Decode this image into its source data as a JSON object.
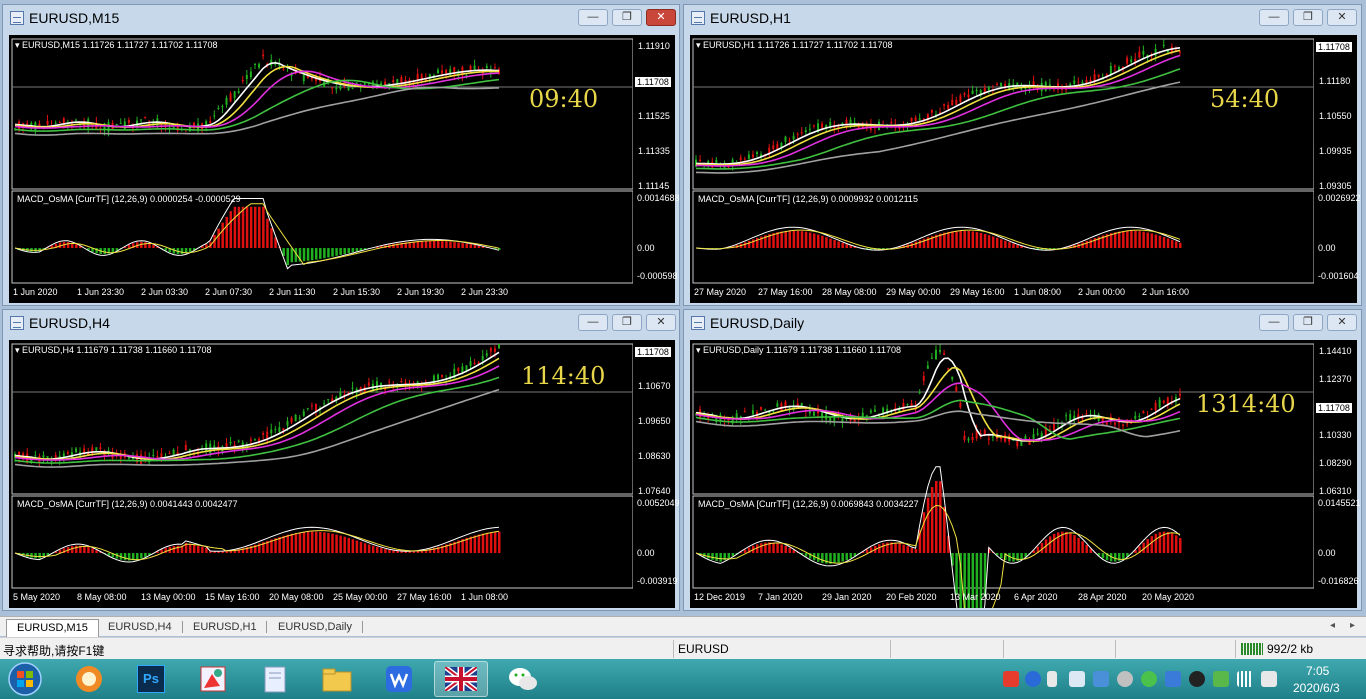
{
  "windows": [
    {
      "id": "m15",
      "title": "EURUSD,M15",
      "active": true,
      "info": "EURUSD,M15  1.11726 1.11727 1.11702 1.11708",
      "price_labels": [
        "1.11910",
        "1.11708",
        "1.11525",
        "1.11335",
        "1.11145"
      ],
      "current_price": "1.11708",
      "clock": "09:40",
      "macd_info": "MACD_OsMA [CurrTF] (12,26,9) 0.0000254 -0.0000529",
      "macd_labels": [
        "0.0014688",
        "0.00",
        "-0.000598"
      ],
      "time_labels": [
        "1 Jun 2020",
        "1 Jun 23:30",
        "2 Jun 03:30",
        "2 Jun 07:30",
        "2 Jun 11:30",
        "2 Jun 15:30",
        "2 Jun 19:30",
        "2 Jun 23:30"
      ]
    },
    {
      "id": "h1",
      "title": "EURUSD,H1",
      "active": false,
      "info": "EURUSD,H1  1.11726 1.11727 1.11702 1.11708",
      "price_labels": [
        "1.11708",
        "1.11180",
        "1.10550",
        "1.09935",
        "1.09305"
      ],
      "current_price": "1.11708",
      "clock": "54:40",
      "macd_info": "MACD_OsMA [CurrTF] (12,26,9) 0.0009932 0.0012115",
      "macd_labels": [
        "0.0026922",
        "0.00",
        "-0.001604"
      ],
      "time_labels": [
        "27 May 2020",
        "27 May 16:00",
        "28 May 08:00",
        "29 May 00:00",
        "29 May 16:00",
        "1 Jun 08:00",
        "2 Jun 00:00",
        "2 Jun 16:00"
      ]
    },
    {
      "id": "h4",
      "title": "EURUSD,H4",
      "active": false,
      "info": "EURUSD,H4  1.11679 1.11738 1.11660 1.11708",
      "price_labels": [
        "1.11708",
        "1.10670",
        "1.09650",
        "1.08630",
        "1.07640"
      ],
      "current_price": "1.11708",
      "clock": "114:40",
      "macd_info": "MACD_OsMA [CurrTF] (12,26,9) 0.0041443 0.0042477",
      "macd_labels": [
        "0.0052049",
        "0.00",
        "-0.003919"
      ],
      "time_labels": [
        "5 May 2020",
        "8 May 08:00",
        "13 May 00:00",
        "15 May 16:00",
        "20 May 08:00",
        "25 May 00:00",
        "27 May 16:00",
        "1 Jun 08:00"
      ]
    },
    {
      "id": "d1",
      "title": "EURUSD,Daily",
      "active": false,
      "info": "EURUSD,Daily  1.11679 1.11738 1.11660 1.11708",
      "price_labels": [
        "1.14410",
        "1.12370",
        "1.11708",
        "1.10330",
        "1.08290",
        "1.06310"
      ],
      "current_price": "1.11708",
      "clock": "1314:40",
      "macd_info": "MACD_OsMA [CurrTF] (12,26,9) 0.0069843 0.0034227",
      "macd_labels": [
        "0.0145521",
        "0.00",
        "-0.016826"
      ],
      "time_labels": [
        "12 Dec 2019",
        "7 Jan 2020",
        "29 Jan 2020",
        "20 Feb 2020",
        "13 Mar 2020",
        "6 Apr 2020",
        "28 Apr 2020",
        "20 May 2020"
      ]
    }
  ],
  "tabs": [
    "EURUSD,M15",
    "EURUSD,H4",
    "EURUSD,H1",
    "EURUSD,Daily"
  ],
  "active_tab": "EURUSD,M15",
  "status": {
    "help": "寻求帮助,请按F1键",
    "symbol": "EURUSD",
    "traffic": "992/2 kb"
  },
  "taskbar": {
    "apps": [
      "start-orb",
      "firefox-like-browser",
      "photoshop",
      "paint-tool",
      "notes",
      "file-explorer",
      "wps-writer",
      "metatrader-uk-flag",
      "wechat"
    ],
    "ps_label": "Ps",
    "time": "7:05",
    "date": "2020/6/3"
  },
  "colors": {
    "bull": "#e01010",
    "bear": "#20b020",
    "ma_fast": "#ffffff",
    "ma_yellow": "#f0e040",
    "ma_magenta": "#e030e0",
    "ma_green": "#40c040",
    "ma_gray": "#a0a0a0",
    "clock": "#e8d64a"
  }
}
